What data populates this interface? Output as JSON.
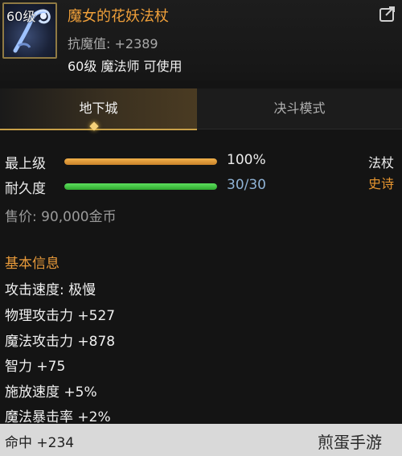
{
  "item": {
    "level_badge": "60级",
    "name": "魔女的花妖法杖",
    "resistance": "抗魔值: +2389",
    "usable": "60级 魔法师 可使用"
  },
  "tabs": [
    {
      "label": "地下城",
      "active": true
    },
    {
      "label": "决斗模式",
      "active": false
    }
  ],
  "stats": {
    "upgrade_label": "最上级",
    "upgrade_value": "100%",
    "upgrade_fraction": 1.0,
    "durability_label": "耐久度",
    "durability_value": "30/30",
    "durability_fraction": 1.0,
    "price": "售价: 90,000金币"
  },
  "item_type": {
    "category": "法杖",
    "rarity": "史诗"
  },
  "basic_info": {
    "title": "基本信息",
    "attributes": [
      "攻击速度: 极慢",
      "物理攻击力 +527",
      "魔法攻击力 +878",
      "智力 +75",
      "施放速度 +5%",
      "魔法暴击率 +2%"
    ],
    "footer_attribute": "命中 +234"
  },
  "watermark": "煎蛋手游",
  "colors": {
    "item_name": "#f0a03a",
    "rarity": "#e8962f",
    "durability_text": "#8fb3d6",
    "section_title": "#e89a3a"
  },
  "icons": {
    "item": "staff-icon",
    "share": "share-icon"
  }
}
